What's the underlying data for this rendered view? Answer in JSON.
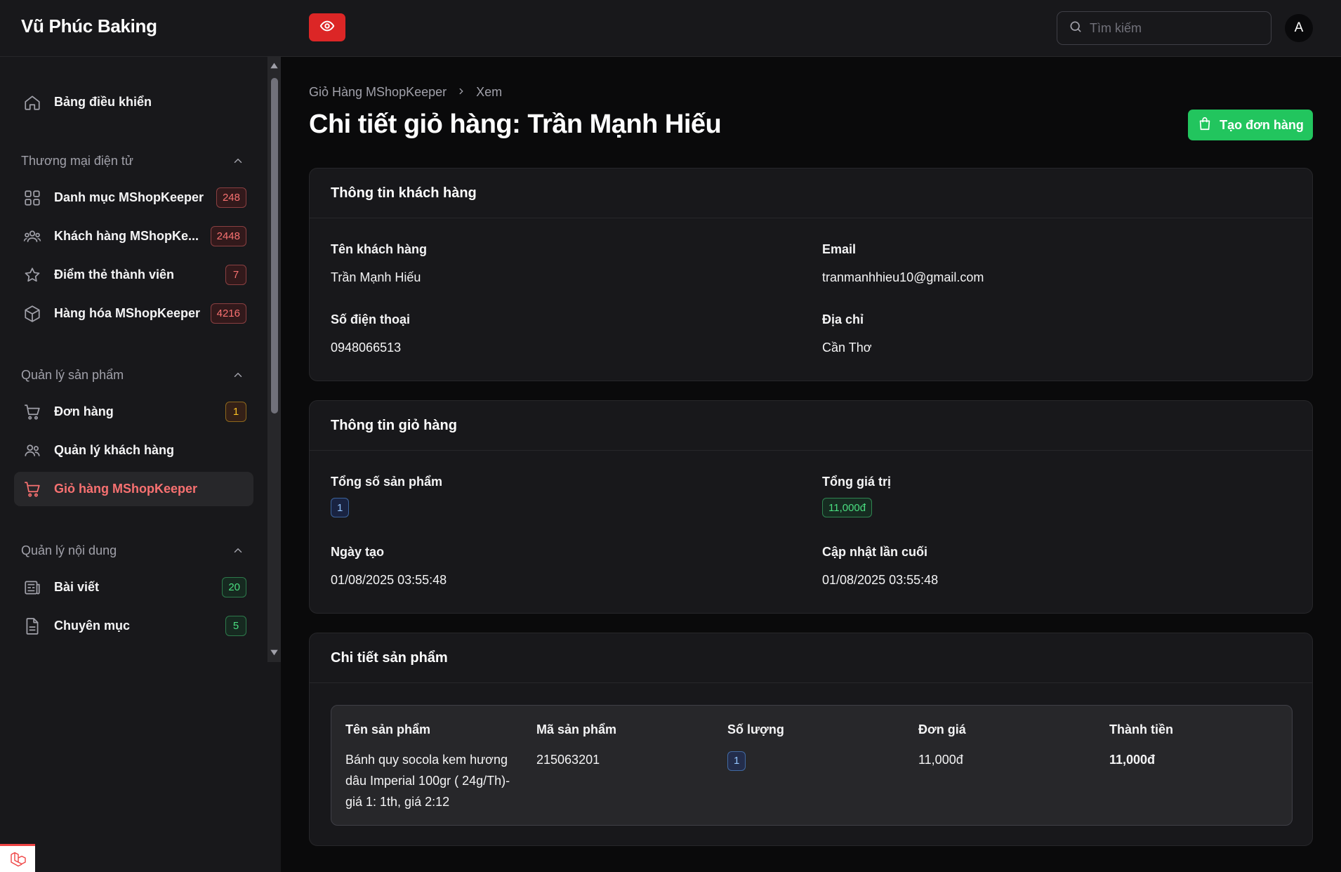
{
  "app": {
    "brand": "Vũ Phúc Baking"
  },
  "search": {
    "placeholder": "Tìm kiếm"
  },
  "user": {
    "avatar_initial": "A"
  },
  "sidebar": {
    "dashboard": {
      "label": "Bảng điều khiển"
    },
    "groups": [
      {
        "label": "Thương mại điện tử"
      },
      {
        "label": "Quản lý sản phẩm"
      },
      {
        "label": "Quản lý nội dung"
      }
    ],
    "items": [
      {
        "label": "Danh mục MShopKeeper",
        "badge": "248"
      },
      {
        "label": "Khách hàng MShopKe...",
        "badge": "2448"
      },
      {
        "label": "Điểm thẻ thành viên",
        "badge": "7"
      },
      {
        "label": "Hàng hóa MShopKeeper",
        "badge": "4216"
      },
      {
        "label": "Đơn hàng",
        "badge": "1"
      },
      {
        "label": "Quản lý khách hàng",
        "badge": ""
      },
      {
        "label": "Giỏ hàng MShopKeeper",
        "badge": ""
      },
      {
        "label": "Bài viết",
        "badge": "20"
      },
      {
        "label": "Chuyên mục",
        "badge": "5"
      }
    ]
  },
  "breadcrumb": {
    "parent": "Giỏ Hàng MShopKeeper",
    "current": "Xem"
  },
  "page": {
    "title": "Chi tiết giỏ hàng: Trần Mạnh Hiếu",
    "create_order_label": "Tạo đơn hàng"
  },
  "customer_card": {
    "title": "Thông tin khách hàng",
    "name_label": "Tên khách hàng",
    "name_value": "Trần Mạnh Hiếu",
    "email_label": "Email",
    "email_value": "tranmanhhieu10@gmail.com",
    "phone_label": "Số điện thoại",
    "phone_value": "0948066513",
    "address_label": "Địa chỉ",
    "address_value": "Cần Thơ"
  },
  "cart_card": {
    "title": "Thông tin giỏ hàng",
    "total_items_label": "Tổng số sản phẩm",
    "total_items_value": "1",
    "total_value_label": "Tổng giá trị",
    "total_value_value": "11,000đ",
    "created_label": "Ngày tạo",
    "created_value": "01/08/2025 03:55:48",
    "updated_label": "Cập nhật lần cuối",
    "updated_value": "01/08/2025 03:55:48"
  },
  "products_card": {
    "title": "Chi tiết sản phẩm",
    "columns": [
      "Tên sản phẩm",
      "Mã sản phẩm",
      "Số lượng",
      "Đơn giá",
      "Thành tiền"
    ],
    "rows": [
      {
        "name": "Bánh quy socola kem hương dâu Imperial 100gr ( 24g/Th)- giá 1: 1th, giá 2:12",
        "code": "215063201",
        "qty": "1",
        "unit_price": "11,000đ",
        "total": "11,000đ"
      }
    ]
  },
  "colors": {
    "accent_red": "#dc2626",
    "accent_green": "#22c55e",
    "active_text": "#f87171"
  },
  "icons": [
    "eye-icon",
    "search-icon",
    "home-icon",
    "grid-icon",
    "users-icon",
    "star-icon",
    "cube-icon",
    "cart-icon",
    "user-group-icon",
    "newspaper-icon",
    "document-icon",
    "shopping-bag-icon",
    "chevron-up-icon",
    "chevron-right-icon"
  ]
}
